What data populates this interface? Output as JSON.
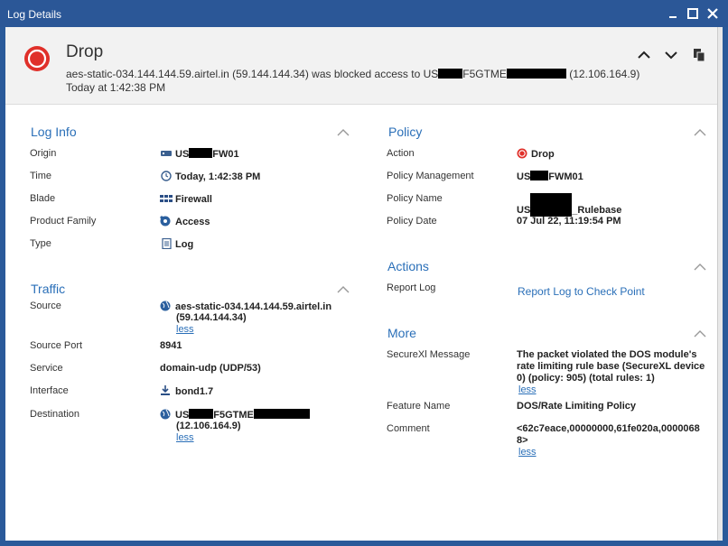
{
  "window": {
    "title": "Log Details"
  },
  "header": {
    "title": "Drop",
    "desc_prefix": "aes-static-034.144.144.59.airtel.in (59.144.144.34) was blocked access to US",
    "desc_mid": "F5GTME",
    "desc_suffix": "(12.106.164.9)",
    "time": "Today at  1:42:38 PM"
  },
  "log_info": {
    "title": "Log Info",
    "origin_label": "Origin",
    "origin_prefix": "US",
    "origin_suffix": "FW01",
    "time_label": "Time",
    "time_value": "Today, 1:42:38 PM",
    "blade_label": "Blade",
    "blade_value": "Firewall",
    "family_label": "Product Family",
    "family_value": "Access",
    "type_label": "Type",
    "type_value": "Log"
  },
  "traffic": {
    "title": "Traffic",
    "source_label": "Source",
    "source_line1": "aes-static-034.144.144.59.airtel.in",
    "source_line2": "(59.144.144.34)",
    "less": "less",
    "port_label": "Source Port",
    "port_value": "8941",
    "service_label": "Service",
    "service_value": "domain-udp (UDP/53)",
    "interface_label": "Interface",
    "interface_value": "bond1.7",
    "dest_label": "Destination",
    "dest_prefix": "US",
    "dest_mid": "F5GTME",
    "dest_line2": "(12.106.164.9)"
  },
  "policy": {
    "title": "Policy",
    "action_label": "Action",
    "action_value": "Drop",
    "mgmt_label": "Policy Management",
    "mgmt_prefix": "US",
    "mgmt_suffix": "FWM01",
    "name_label": "Policy Name",
    "name_prefix": "US",
    "name_suffix": "_Rulebase",
    "date_label": "Policy Date",
    "date_value": "07 Jul 22, 11:19:54 PM"
  },
  "actions": {
    "title": "Actions",
    "report_label": "Report Log",
    "report_link": "Report Log to Check Point"
  },
  "more": {
    "title": "More",
    "securexl_label": "SecureXl Message",
    "securexl_line1": "The packet violated the DOS module's",
    "securexl_line2": "rate limiting rule base (SecureXL device",
    "securexl_line3": "0) (policy: 905) (total rules: 1)",
    "feature_label": "Feature Name",
    "feature_value": "DOS/Rate Limiting Policy",
    "comment_label": "Comment",
    "comment_line1": "<62c7eace,00000000,61fe020a,0000068",
    "comment_line2": "8>"
  },
  "colors": {
    "accent": "#2a6fb8",
    "titlebar": "#2b5797",
    "drop_red": "#e0302a"
  }
}
